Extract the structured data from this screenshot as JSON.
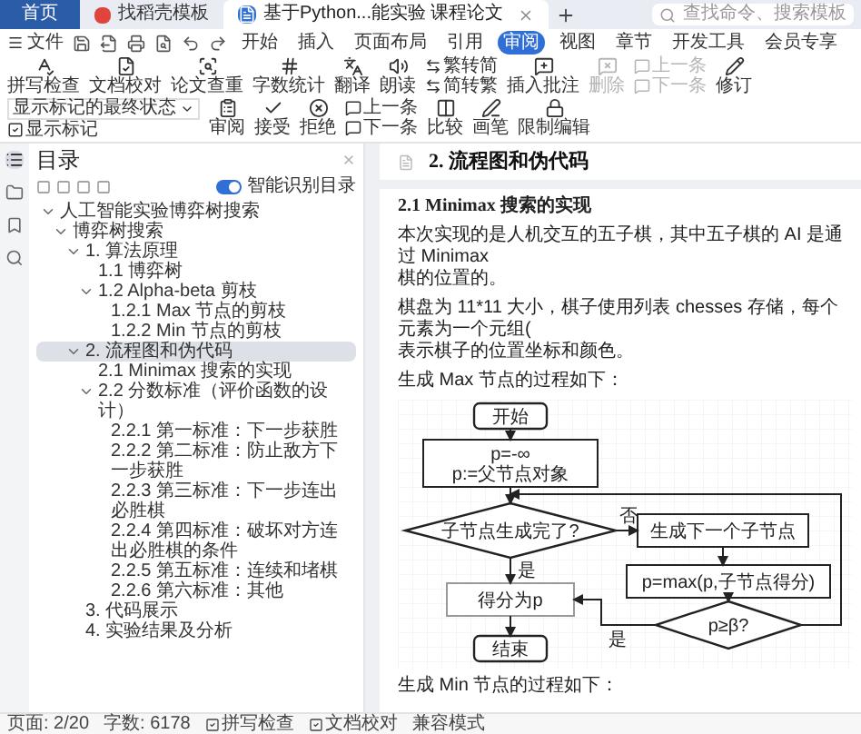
{
  "tabs": [
    {
      "kind": "home",
      "label": "首页",
      "selected": false
    },
    {
      "kind": "template",
      "label": "找稻壳模板",
      "selected": false
    },
    {
      "kind": "document",
      "label": "基于Python...能实验 课程论文",
      "selected": true
    }
  ],
  "search": {
    "placeholder": "查找命令、搜索模板"
  },
  "menu": {
    "file": "文件",
    "tabs": [
      {
        "label": "开始",
        "selected": false
      },
      {
        "label": "插入",
        "selected": false
      },
      {
        "label": "页面布局",
        "selected": false
      },
      {
        "label": "引用",
        "selected": false
      },
      {
        "label": "审阅",
        "selected": true
      },
      {
        "label": "视图",
        "selected": false
      },
      {
        "label": "章节",
        "selected": false
      },
      {
        "label": "开发工具",
        "selected": false
      },
      {
        "label": "会员专享",
        "selected": false
      }
    ]
  },
  "ribbon": [
    {
      "kind": "large",
      "label": "拼写检查",
      "disabled": false
    },
    {
      "kind": "large",
      "label": "文档校对",
      "disabled": false
    },
    {
      "kind": "large",
      "label": "论文查重",
      "disabled": false
    },
    {
      "kind": "large",
      "label": "字数统计",
      "disabled": false
    },
    {
      "kind": "large",
      "label": "翻译",
      "disabled": false
    },
    {
      "kind": "large",
      "label": "朗读",
      "disabled": false
    },
    {
      "kind": "pair",
      "labels": [
        "繁转简",
        "简转繁"
      ],
      "disabled": false
    },
    {
      "kind": "large",
      "label": "插入批注",
      "disabled": false
    },
    {
      "kind": "large",
      "label": "删除",
      "disabled": true
    },
    {
      "kind": "pair",
      "labels": [
        "上一条",
        "下一条"
      ],
      "disabled": true
    },
    {
      "kind": "large",
      "label": "修订",
      "disabled": false
    },
    {
      "kind": "select",
      "value": "显示标记的最终状态",
      "label": "显示标记",
      "disabled": false
    },
    {
      "kind": "large",
      "label": "审阅",
      "disabled": false
    },
    {
      "kind": "large",
      "label": "接受",
      "disabled": false
    },
    {
      "kind": "large",
      "label": "拒绝",
      "disabled": false
    },
    {
      "kind": "pair",
      "labels": [
        "上一条",
        "下一条"
      ],
      "disabled": false
    },
    {
      "kind": "large",
      "label": "比较",
      "disabled": false
    },
    {
      "kind": "large",
      "label": "画笔",
      "disabled": false
    },
    {
      "kind": "large",
      "label": "限制编辑",
      "disabled": false
    }
  ],
  "side_tabs": [
    {
      "selected": true
    },
    {
      "selected": false
    },
    {
      "selected": false
    },
    {
      "selected": false
    }
  ],
  "toc_panel": {
    "title": "目录",
    "smart_toc": {
      "label": "智能识别目录",
      "on": true
    }
  },
  "toc": [
    {
      "label": "人工智能实验博弈树搜索",
      "expanded": true,
      "selected": false,
      "children": [
        {
          "label": "博弈树搜索",
          "expanded": true,
          "selected": false,
          "children": [
            {
              "label": "1. 算法原理",
              "expanded": true,
              "selected": false,
              "children": [
                {
                  "label": "1.1 博弈树",
                  "selected": false
                },
                {
                  "label": "1.2 Alpha-beta 剪枝",
                  "expanded": true,
                  "selected": false,
                  "children": [
                    {
                      "label": "1.2.1 Max 节点的剪枝",
                      "selected": false
                    },
                    {
                      "label": "1.2.2 Min 节点的剪枝",
                      "selected": false
                    }
                  ]
                }
              ]
            },
            {
              "label": "2. 流程图和伪代码",
              "expanded": true,
              "selected": true,
              "children": [
                {
                  "label": "2.1 Minimax 搜索的实现",
                  "selected": false
                },
                {
                  "label": "2.2 分数标准（评价函数的设计）",
                  "expanded": true,
                  "selected": false,
                  "children": [
                    {
                      "label": "2.2.1 第一标准：下一步获胜",
                      "selected": false
                    },
                    {
                      "label": "2.2.2 第二标准：防止敌方下一步获胜",
                      "selected": false
                    },
                    {
                      "label": "2.2.3 第三标准：下一步连出必胜棋",
                      "selected": false
                    },
                    {
                      "label": "2.2.4 第四标准：破坏对方连出必胜棋的条件",
                      "selected": false
                    },
                    {
                      "label": "2.2.5 第五标准：连续和堵棋",
                      "selected": false
                    },
                    {
                      "label": "2.2.6 第六标准：其他",
                      "selected": false
                    }
                  ]
                }
              ]
            },
            {
              "label": "3. 代码展示",
              "selected": false
            },
            {
              "label": "4. 实验结果及分析",
              "selected": false
            }
          ]
        }
      ]
    }
  ],
  "document": {
    "page_heading": "2. 流程图和伪代码",
    "section_heading": "2.1 Minimax 搜索的实现",
    "paragraphs": [
      [
        "本次实现的是人机交互的五子棋，其中五子棋的 AI 是通过 Minimax",
        "棋的位置的。"
      ],
      [
        "棋盘为 11*11 大小，棋子使用列表 chesses 存储，每个元素为一个元组(",
        "表示棋子的位置坐标和颜色。"
      ]
    ],
    "caption_max": "生成 Max 节点的过程如下：",
    "flowchart": {
      "nodes": [
        {
          "kind": "terminal",
          "lines": [
            "开始"
          ]
        },
        {
          "kind": "process",
          "lines": [
            "p=-∞",
            "p:=父节点对象"
          ]
        },
        {
          "kind": "decision",
          "lines": [
            "子节点生成完了?"
          ]
        },
        {
          "kind": "process",
          "lines": [
            "生成下一个子节点"
          ]
        },
        {
          "kind": "process",
          "lines": [
            "p=max(p,子节点得分)"
          ]
        },
        {
          "kind": "result",
          "lines": [
            "得分为p"
          ]
        },
        {
          "kind": "decision",
          "lines": [
            "p≥β?"
          ]
        },
        {
          "kind": "terminal",
          "lines": [
            "结束"
          ]
        }
      ],
      "edge_labels": [
        "否",
        "是",
        "是"
      ]
    },
    "caption_min": "生成 Min 节点的过程如下："
  },
  "status_bar": {
    "page": "页面: 2/20",
    "words": "字数: 6178",
    "tools": [
      "拼写检查",
      "文档校对"
    ],
    "mode": "兼容模式"
  }
}
